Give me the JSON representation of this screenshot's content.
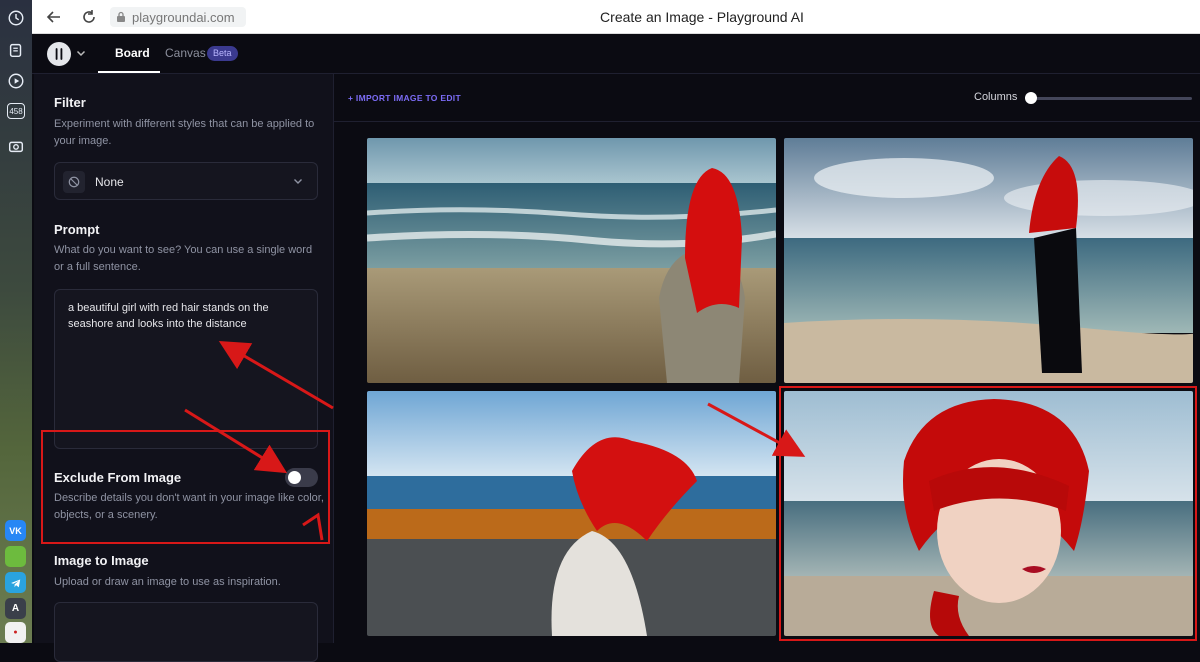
{
  "browser": {
    "url": "playgroundai.com",
    "window_title": "Create an Image - Playground AI"
  },
  "os_sidebar": {
    "counter_badge": "458"
  },
  "header": {
    "tabs": [
      {
        "label": "Board",
        "active": true
      },
      {
        "label": "Canvas",
        "active": false
      }
    ],
    "beta_badge": "Beta"
  },
  "sidebar": {
    "filter": {
      "title": "Filter",
      "description": "Experiment with different styles that can be applied to your image.",
      "selected": "None"
    },
    "prompt": {
      "title": "Prompt",
      "description": "What do you want to see? You can use a single word or a full sentence.",
      "value": "a beautiful girl with red hair stands on the seashore and looks into the distance"
    },
    "exclude": {
      "title": "Exclude From Image",
      "description": "Describe details you don't want in your image like color, objects, or a scenery.",
      "toggle_on": false
    },
    "image_to_image": {
      "title": "Image to Image",
      "description": "Upload or draw an image to use as inspiration."
    }
  },
  "toolbar": {
    "import_label": "+ IMPORT IMAGE TO EDIT",
    "columns_label": "Columns",
    "columns_value": 0
  },
  "gallery": [
    {
      "alt": "girl with red hair seen from behind on beach"
    },
    {
      "alt": "girl with red hair in black dress on beach"
    },
    {
      "alt": "girl with flying red hair at sea"
    },
    {
      "alt": "portrait of girl with red hair at sea"
    }
  ],
  "annotation": {
    "marker": "1",
    "color": "#d81818"
  }
}
